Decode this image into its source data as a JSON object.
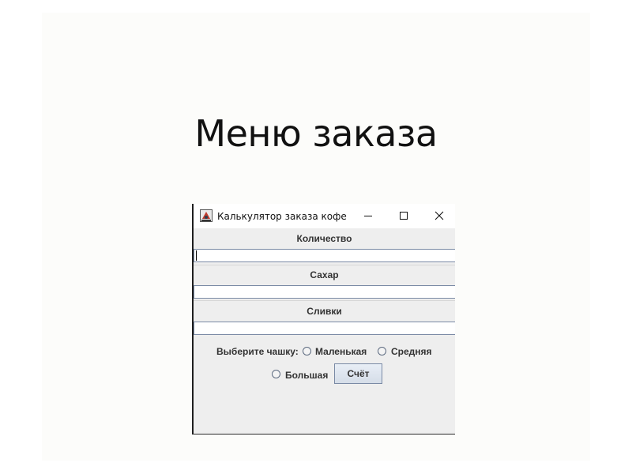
{
  "slide": {
    "title": "Меню заказа"
  },
  "window": {
    "title": "Калькулятор заказа кофе",
    "controls": {
      "minimize_icon": "minimize-icon",
      "maximize_icon": "maximize-icon",
      "close_icon": "close-icon"
    }
  },
  "form": {
    "quantity_label": "Количество",
    "quantity_value": "",
    "sugar_label": "Сахар",
    "sugar_value": "",
    "cream_label": "Сливки",
    "cream_value": "",
    "cup_prompt": "Выберите чашку:",
    "cup_options": [
      "Маленькая",
      "Средняя",
      "Большая"
    ],
    "bill_button": "Счёт"
  },
  "colors": {
    "window_bg": "#eeeeee",
    "input_border": "#7a8aa5",
    "button_border": "#7a8aa5"
  }
}
